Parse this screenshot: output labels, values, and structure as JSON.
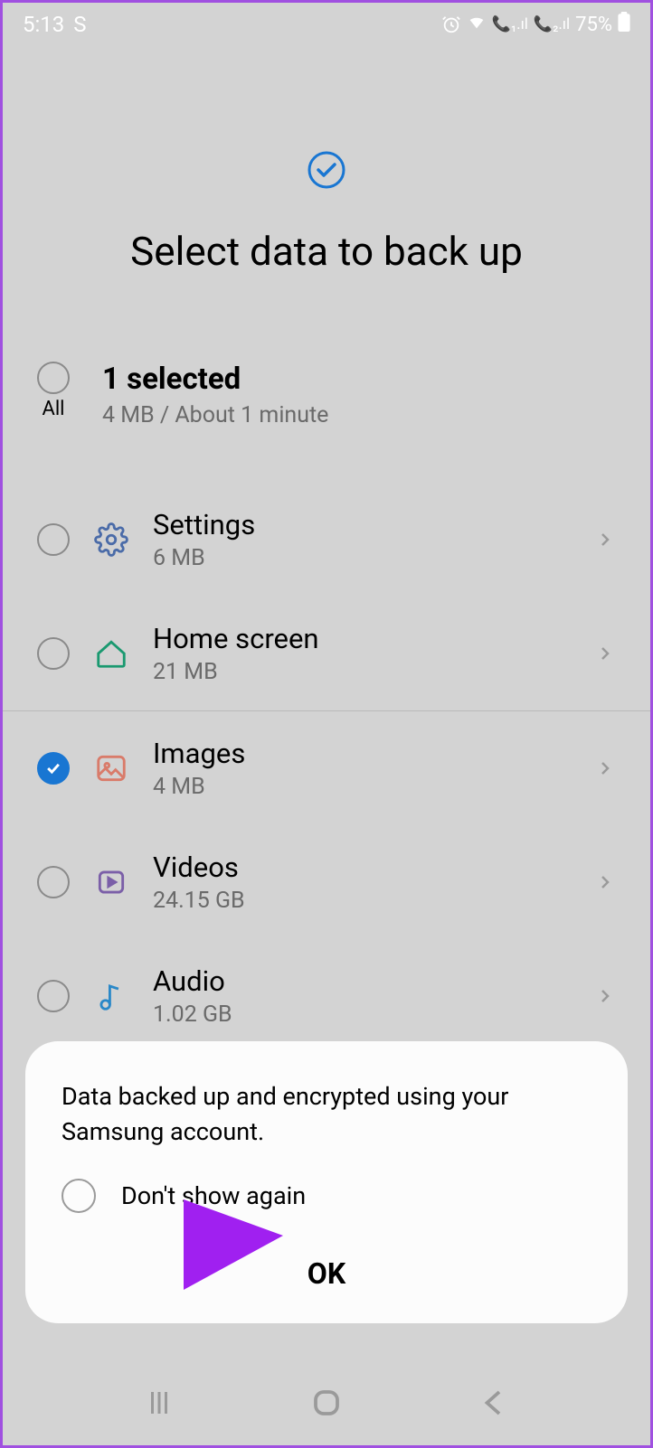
{
  "status_bar": {
    "time": "5:13",
    "indicator": "S",
    "battery": "75%"
  },
  "header": {
    "title": "Select data to back up"
  },
  "selection": {
    "all_label": "All",
    "count_label": "1 selected",
    "size_label": "4 MB / About 1 minute"
  },
  "items": [
    {
      "title": "Settings",
      "subtitle": "6 MB",
      "checked": false,
      "icon": "gear"
    },
    {
      "title": "Home screen",
      "subtitle": "21 MB",
      "checked": false,
      "icon": "home"
    },
    {
      "title": "Images",
      "subtitle": "4 MB",
      "checked": true,
      "icon": "image"
    },
    {
      "title": "Videos",
      "subtitle": "24.15 GB",
      "checked": false,
      "icon": "video"
    },
    {
      "title": "Audio",
      "subtitle": "1.02 GB",
      "checked": false,
      "icon": "audio"
    }
  ],
  "dialog": {
    "message": "Data backed up and encrypted using your Samsung account.",
    "dont_show_label": "Don't show again",
    "ok_label": "OK"
  },
  "colors": {
    "accent": "#1976d2",
    "arrow": "#a020f0"
  }
}
